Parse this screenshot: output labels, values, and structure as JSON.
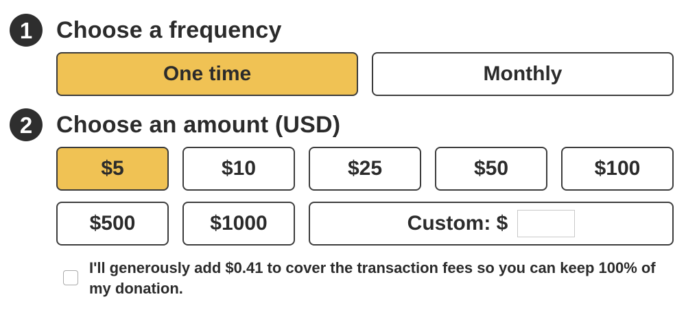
{
  "step1": {
    "number": "1",
    "title": "Choose a frequency"
  },
  "frequency": {
    "options": [
      "One time",
      "Monthly"
    ],
    "selected": "One time"
  },
  "step2": {
    "number": "2",
    "title": "Choose an amount (USD)"
  },
  "amounts": {
    "options": [
      "$5",
      "$10",
      "$25",
      "$50",
      "$100",
      "$500",
      "$1000"
    ],
    "selected": "$5",
    "custom_label": "Custom: $",
    "custom_value": ""
  },
  "fees": {
    "label": "I'll generously add $0.41 to cover the transaction fees so you can keep 100% of my donation.",
    "checked": false
  },
  "colors": {
    "selected": "#f0c254",
    "border": "#3c3c3c",
    "badge": "#2e2e2e"
  }
}
